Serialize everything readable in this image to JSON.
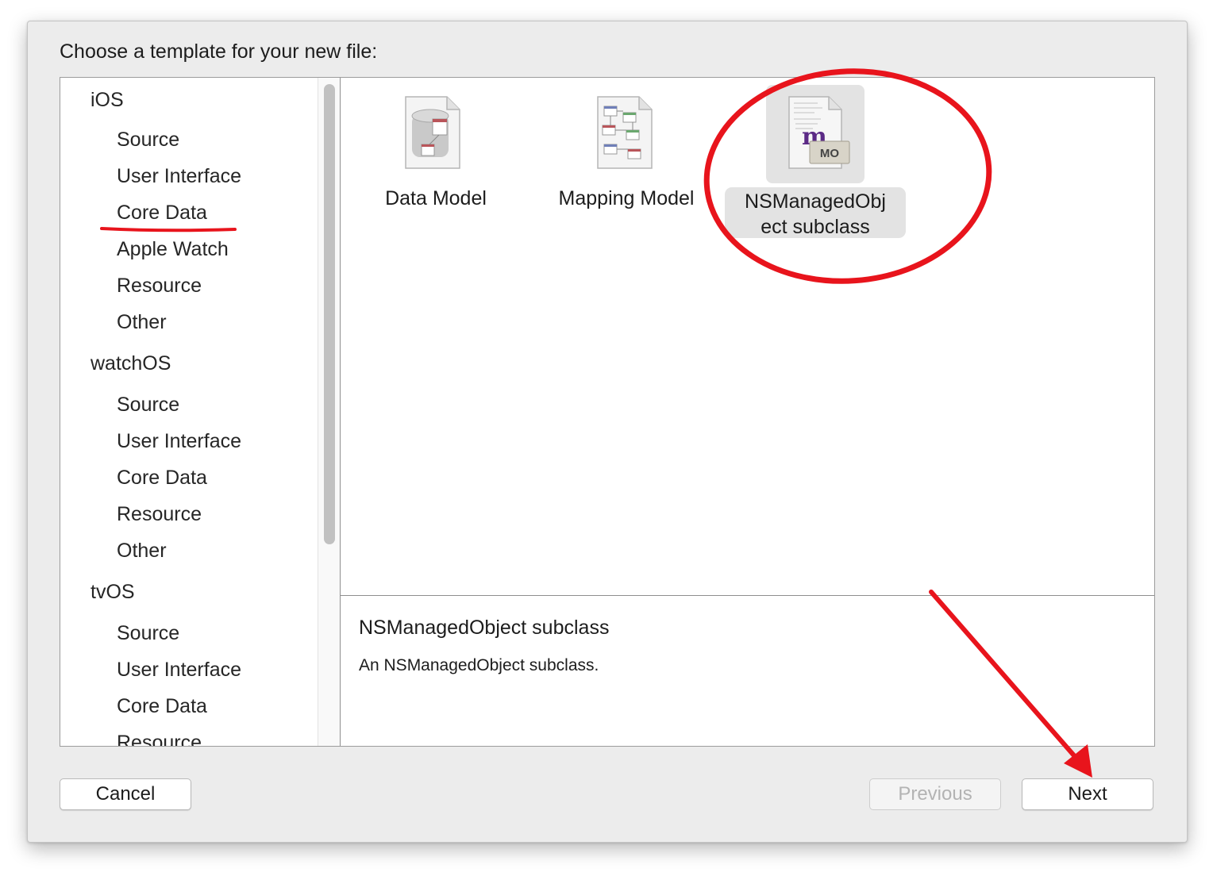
{
  "dialog": {
    "prompt": "Choose a template for your new file:",
    "sidebar": {
      "platforms": [
        {
          "name": "iOS",
          "categories": [
            "Source",
            "User Interface",
            "Core Data",
            "Apple Watch",
            "Resource",
            "Other"
          ]
        },
        {
          "name": "watchOS",
          "categories": [
            "Source",
            "User Interface",
            "Core Data",
            "Resource",
            "Other"
          ]
        },
        {
          "name": "tvOS",
          "categories": [
            "Source",
            "User Interface",
            "Core Data",
            "Resource"
          ]
        }
      ],
      "highlighted_category": "Core Data"
    },
    "templates": [
      {
        "name": "Data Model",
        "icon": "data-model-icon"
      },
      {
        "name": "Mapping Model",
        "icon": "mapping-model-icon"
      },
      {
        "name_line1": "NSManagedObj",
        "name_line2": "ect subclass",
        "icon": "nsmanagedobject-icon",
        "icon_badge": "MO",
        "icon_letter": "m",
        "selected": true
      }
    ],
    "description": {
      "title": "NSManagedObject subclass",
      "text": "An NSManagedObject subclass."
    },
    "buttons": {
      "cancel": "Cancel",
      "previous": "Previous",
      "next": "Next"
    }
  },
  "colors": {
    "annotation_red": "#e8141c",
    "selection_gray": "#e3e3e3",
    "dialog_bg": "#ececec"
  }
}
